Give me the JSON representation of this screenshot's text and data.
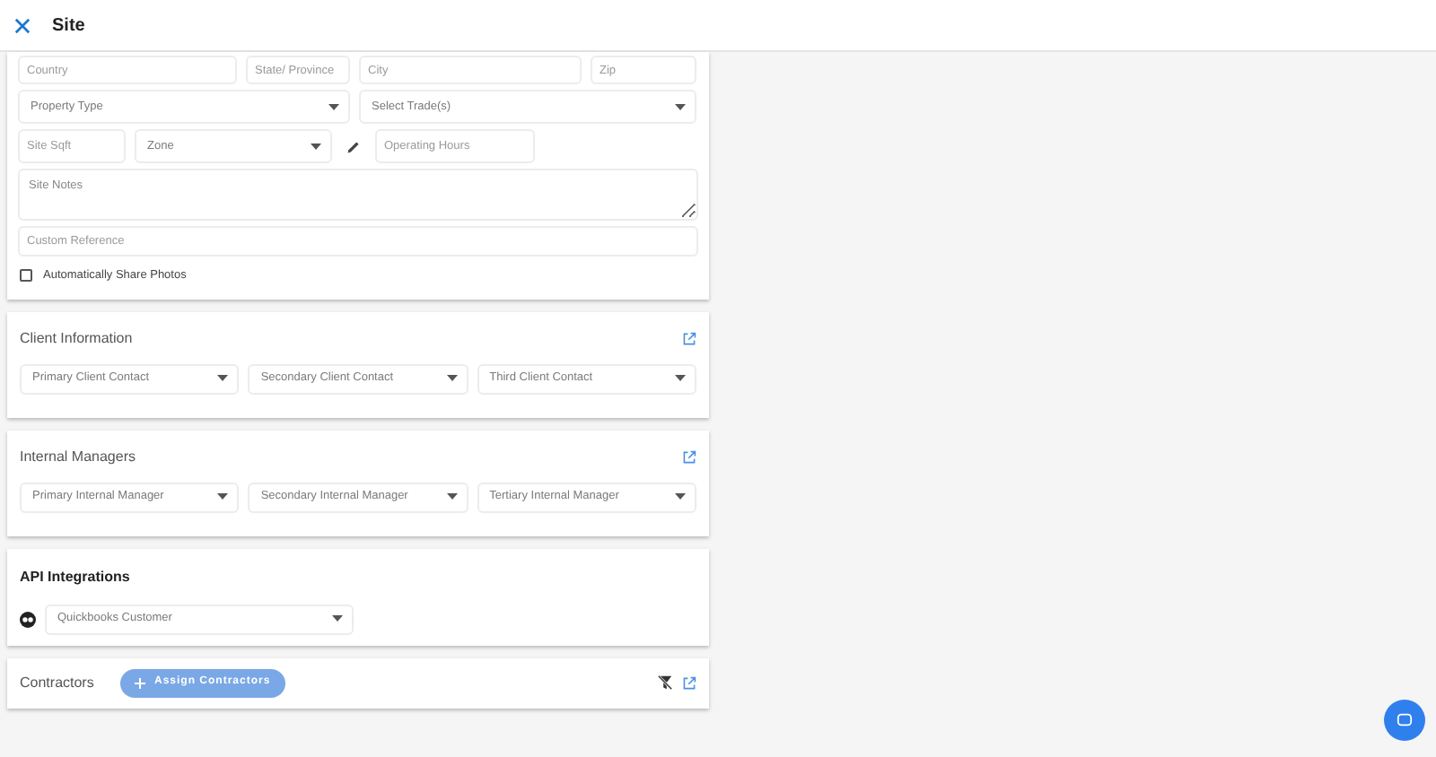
{
  "header": {
    "title": "Site"
  },
  "site": {
    "address_fields": [
      {
        "kind": "input",
        "placeholder": "Country"
      },
      {
        "kind": "input",
        "placeholder": "State/ Province"
      },
      {
        "kind": "input",
        "placeholder": "City"
      },
      {
        "kind": "input",
        "placeholder": "Zip"
      }
    ],
    "type_fields": [
      {
        "kind": "select",
        "placeholder": "Property Type"
      },
      {
        "kind": "select",
        "placeholder": "Select Trade(s)"
      }
    ],
    "detail_fields": [
      {
        "kind": "input",
        "placeholder": "Site Sqft"
      },
      {
        "kind": "select",
        "placeholder": "Zone"
      },
      {
        "kind": "edit"
      },
      {
        "kind": "input",
        "placeholder": "Operating Hours"
      }
    ],
    "notes": {
      "kind": "textarea",
      "placeholder": "Site Notes"
    },
    "custom_reference": {
      "kind": "input",
      "placeholder": "Custom Reference"
    },
    "share_photos": {
      "label": "Automatically Share Photos",
      "checked": false
    }
  },
  "client_information": {
    "title": "Client Information",
    "fields": [
      {
        "placeholder": "Primary Client Contact"
      },
      {
        "placeholder": "Secondary Client Contact"
      },
      {
        "placeholder": "Third Client Contact"
      }
    ]
  },
  "internal_managers": {
    "title": "Internal Managers",
    "fields": [
      {
        "placeholder": "Primary Internal Manager"
      },
      {
        "placeholder": "Secondary Internal Manager"
      },
      {
        "placeholder": "Tertiary Internal Manager"
      }
    ]
  },
  "api_integrations": {
    "title": "API Integrations",
    "field": {
      "placeholder": "Quickbooks Customer"
    }
  },
  "contractors": {
    "title": "Contractors",
    "button": "Assign Contractors"
  }
}
